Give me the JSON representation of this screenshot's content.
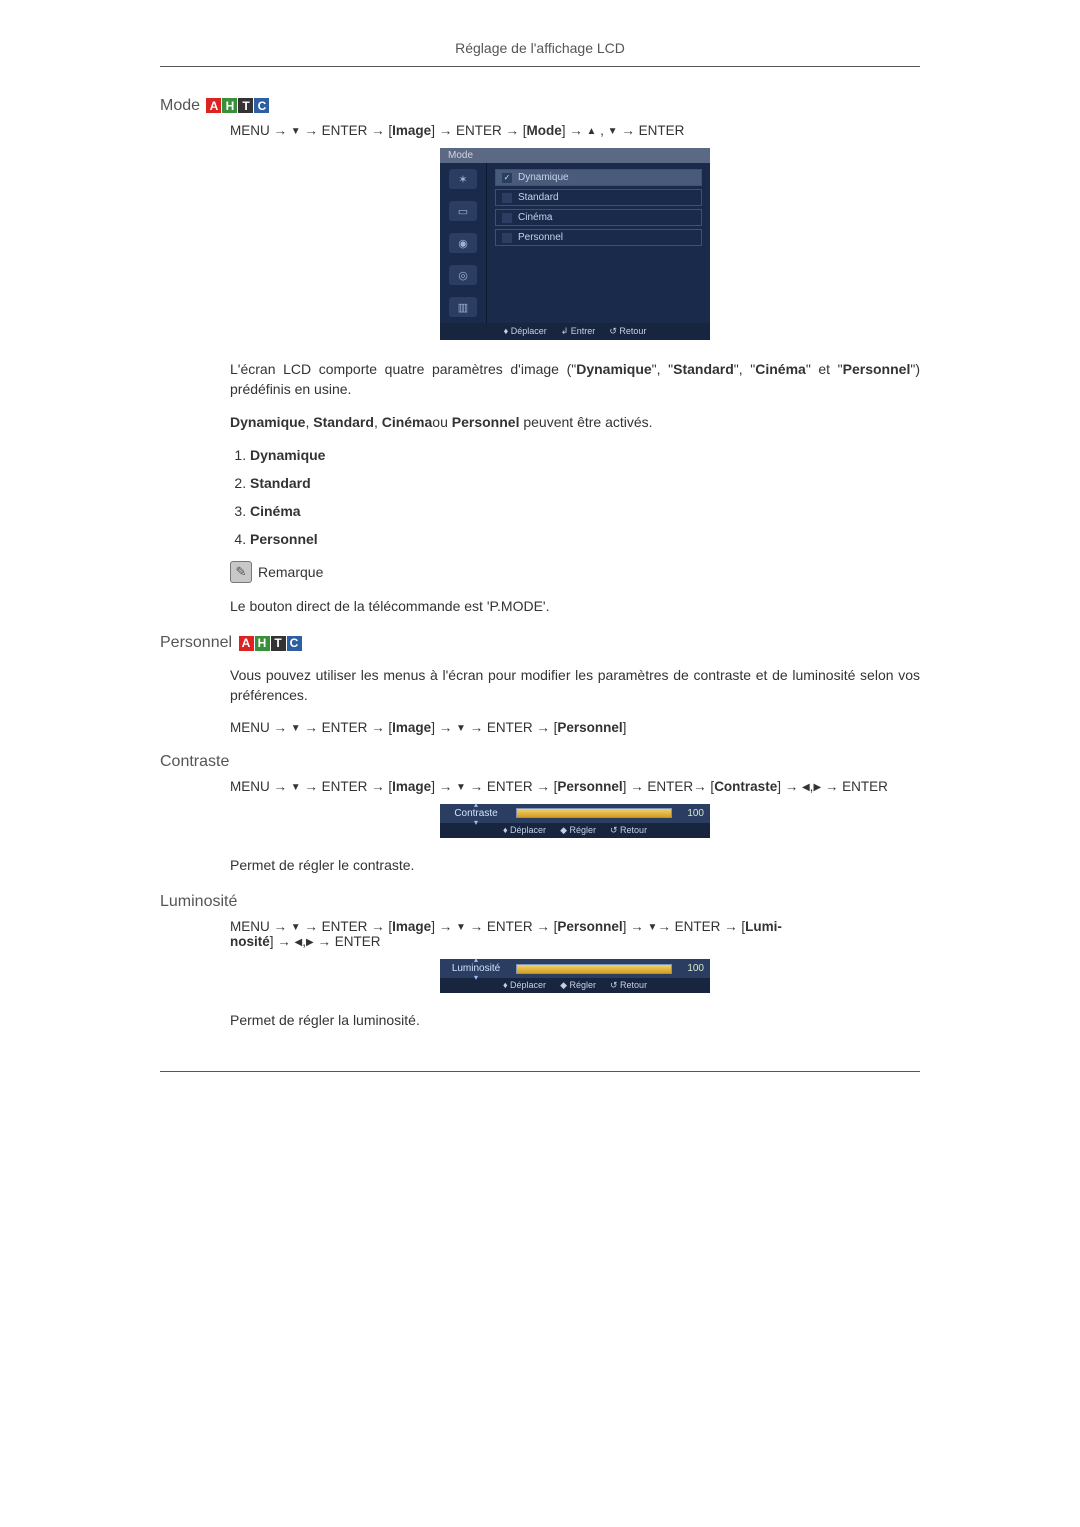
{
  "header": {
    "title": "Réglage de l'affichage LCD"
  },
  "badges": {
    "a": "A",
    "h": "H",
    "t": "T",
    "c": "C"
  },
  "sections": {
    "mode": {
      "title": "Mode",
      "nav_prefix": "MENU → ",
      "nav_enter1": " → ENTER → [",
      "nav_image": "Image",
      "nav_after_image": "] → ENTER → [",
      "nav_mode": "Mode",
      "nav_after_mode": "] → ",
      "nav_tail": " → ENTER",
      "osd": {
        "titlebar": "Mode",
        "items": [
          "Dynamique",
          "Standard",
          "Cinéma",
          "Personnel"
        ],
        "footer": {
          "move": "Déplacer",
          "enter": "Entrer",
          "return": "Retour"
        }
      },
      "para1_a": "L'écran LCD comporte quatre paramètres d'image (\"",
      "para1_b": "Dynamique",
      "para1_c": "\", \"",
      "para1_d": "Standard",
      "para1_e": "\", \"",
      "para1_f": "Cinéma",
      "para1_g": "\" et \"",
      "para1_h": "Personnel",
      "para1_i": "\") prédéfinis en usine.",
      "para2_a": "Dynamique",
      "para2_b": ", ",
      "para2_c": "Standard",
      "para2_d": ", ",
      "para2_e": "Cinéma",
      "para2_f": "ou ",
      "para2_g": "Personnel",
      "para2_h": " peuvent être activés.",
      "list": [
        "Dynamique",
        "Standard",
        "Cinéma",
        "Personnel"
      ],
      "note_label": "Remarque",
      "note_text": "Le bouton direct de la télécommande est 'P.MODE'."
    },
    "personnel": {
      "title": "Personnel",
      "para": "Vous pouvez utiliser les menus à l'écran pour modifier les paramètres de contraste et de luminosité selon vos préférences.",
      "nav_prefix": "MENU → ",
      "nav_mid1": " → ENTER → [",
      "nav_image": "Image",
      "nav_mid2": "] → ",
      "nav_mid3": " → ENTER → [",
      "nav_personnel": "Personnel",
      "nav_end": "]"
    },
    "contraste": {
      "title": "Contraste",
      "nav_prefix": "MENU → ",
      "nav_a": " → ENTER → [",
      "nav_image": "Image",
      "nav_b": "] → ",
      "nav_c": " → ENTER → [",
      "nav_personnel": "Personnel",
      "nav_d": "] → ENTER→ [",
      "nav_contraste": "Contraste",
      "nav_e": "] → ",
      "nav_f": " → ENTER",
      "osd": {
        "label": "Contraste",
        "value": "100",
        "footer": {
          "move": "Déplacer",
          "adjust": "Régler",
          "return": "Retour"
        }
      },
      "desc": "Permet de régler le contraste."
    },
    "luminosite": {
      "title": "Luminosité",
      "nav_prefix": "MENU → ",
      "nav_a": " → ENTER → [",
      "nav_image": "Image",
      "nav_b": "] → ",
      "nav_c": " → ENTER → [",
      "nav_personnel": "Personnel",
      "nav_d": "] → ",
      "nav_e": "→ ENTER → [",
      "nav_lum": "Lumi-",
      "nav_lum2": "nosité",
      "nav_f": "] → ",
      "nav_g": " → ENTER",
      "osd": {
        "label": "Luminosité",
        "value": "100",
        "footer": {
          "move": "Déplacer",
          "adjust": "Régler",
          "return": "Retour"
        }
      },
      "desc": "Permet de régler la luminosité."
    }
  },
  "glyphs": {
    "down": "▼",
    "up": "▲",
    "left": "◀",
    "right": "▶",
    "arrow": "→",
    "comma": " , "
  }
}
